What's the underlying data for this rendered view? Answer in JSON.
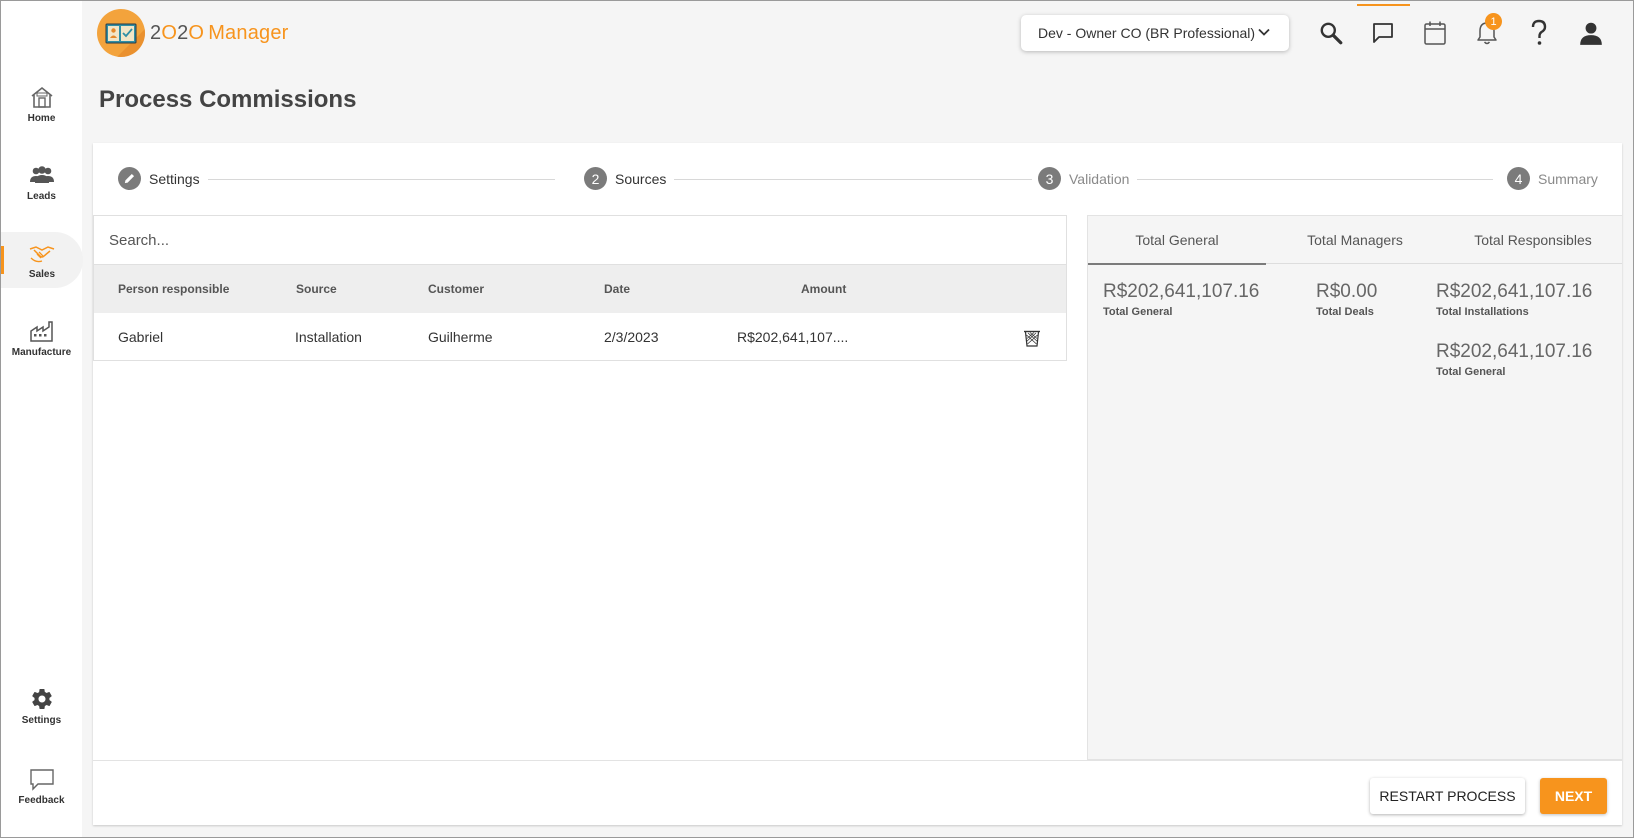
{
  "app": {
    "logo_prefix": "2",
    "logo_o1": "O",
    "logo_mid": "2",
    "logo_o2": "O",
    "logo_suffix": "Manager"
  },
  "page_title": "Process Commissions",
  "header": {
    "company_select": "Dev - Owner CO (BR Professional)",
    "notification_count": "1",
    "icons": [
      "search-icon",
      "chat-icon",
      "calendar-icon",
      "bell-icon",
      "help-icon",
      "user-icon"
    ]
  },
  "sidebar": {
    "items": [
      {
        "label": "Home",
        "icon": "home-icon"
      },
      {
        "label": "Leads",
        "icon": "people-icon"
      },
      {
        "label": "Sales",
        "icon": "handshake-icon",
        "active": true
      },
      {
        "label": "Manufacture",
        "icon": "factory-icon"
      },
      {
        "label": "Settings",
        "icon": "gear-icon"
      },
      {
        "label": "Feedback",
        "icon": "feedback-icon"
      }
    ]
  },
  "stepper": {
    "steps": [
      {
        "number": "",
        "label": "Settings",
        "state": "done"
      },
      {
        "number": "2",
        "label": "Sources",
        "state": "active"
      },
      {
        "number": "3",
        "label": "Validation",
        "state": "inactive"
      },
      {
        "number": "4",
        "label": "Summary",
        "state": "inactive"
      }
    ]
  },
  "search": {
    "placeholder": "Search..."
  },
  "table": {
    "columns": [
      "Person responsible",
      "Source",
      "Customer",
      "Date",
      "Amount"
    ],
    "rows": [
      {
        "person": "Gabriel",
        "source": "Installation",
        "customer": "Guilherme",
        "date": "2/3/2023",
        "amount": "R$202,641,107...."
      }
    ]
  },
  "totals": {
    "tabs": [
      "Total General",
      "Total Managers",
      "Total Responsibles"
    ],
    "active_tab": "Total General",
    "items": [
      {
        "value": "R$202,641,107.16",
        "label": "Total General"
      },
      {
        "value": "R$0.00",
        "label": "Total Deals"
      },
      {
        "value": "R$202,641,107.16",
        "label": "Total Installations"
      },
      {
        "value": "R$202,641,107.16",
        "label": "Total General"
      }
    ]
  },
  "actions": {
    "restart": "RESTART PROCESS",
    "next": "NEXT"
  },
  "colors": {
    "accent": "#f7941d",
    "step_circle": "#7b7b7b",
    "active_tab_underline": "#7b7b7b"
  }
}
